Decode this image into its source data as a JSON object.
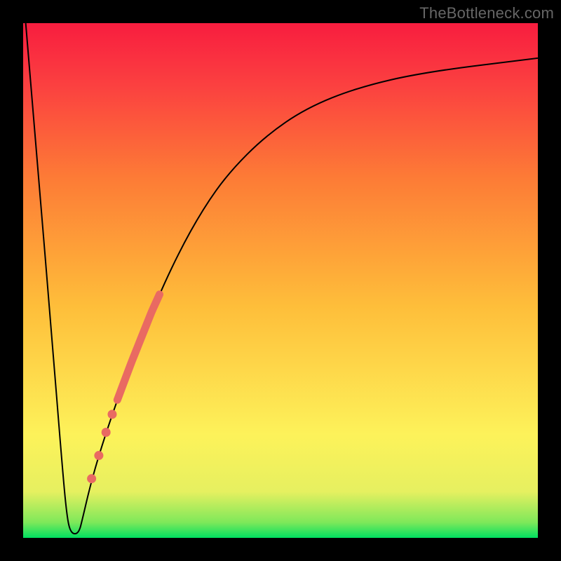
{
  "watermark": "TheBottleneck.com",
  "chart_data": {
    "type": "line",
    "title": "",
    "xlabel": "",
    "ylabel": "",
    "xlim": [
      0,
      100
    ],
    "ylim": [
      0,
      100
    ],
    "gradient_stops": [
      {
        "pos": 0.0,
        "color": "#00E060"
      },
      {
        "pos": 0.03,
        "color": "#7EE85A"
      },
      {
        "pos": 0.09,
        "color": "#E6F060"
      },
      {
        "pos": 0.2,
        "color": "#FDF25A"
      },
      {
        "pos": 0.45,
        "color": "#FEBE3A"
      },
      {
        "pos": 0.7,
        "color": "#FD7B36"
      },
      {
        "pos": 0.88,
        "color": "#FB4040"
      },
      {
        "pos": 1.0,
        "color": "#F81D3F"
      }
    ],
    "series": [
      {
        "name": "bottleneck-curve",
        "stroke": "#000000",
        "stroke_width": 2,
        "points": [
          {
            "x": 0.5,
            "y": 100.0
          },
          {
            "x": 3.0,
            "y": 70.0
          },
          {
            "x": 5.5,
            "y": 40.0
          },
          {
            "x": 7.5,
            "y": 15.0
          },
          {
            "x": 8.5,
            "y": 4.0
          },
          {
            "x": 9.3,
            "y": 0.8
          },
          {
            "x": 10.8,
            "y": 0.8
          },
          {
            "x": 11.6,
            "y": 4.0
          },
          {
            "x": 13.0,
            "y": 10.0
          },
          {
            "x": 15.0,
            "y": 17.0
          },
          {
            "x": 18.0,
            "y": 26.0
          },
          {
            "x": 21.0,
            "y": 34.0
          },
          {
            "x": 25.0,
            "y": 44.0
          },
          {
            "x": 30.0,
            "y": 55.0
          },
          {
            "x": 35.0,
            "y": 64.0
          },
          {
            "x": 40.0,
            "y": 71.0
          },
          {
            "x": 47.0,
            "y": 78.0
          },
          {
            "x": 55.0,
            "y": 83.5
          },
          {
            "x": 65.0,
            "y": 87.5
          },
          {
            "x": 78.0,
            "y": 90.5
          },
          {
            "x": 100.0,
            "y": 93.2
          }
        ]
      }
    ],
    "highlight_segment": {
      "name": "highlighted-range",
      "stroke": "#E96A62",
      "stroke_width": 11,
      "x_start": 18.3,
      "x_end": 26.5
    },
    "highlight_dots": {
      "name": "highlight-dots",
      "fill": "#E96A62",
      "r": 6.5,
      "points": [
        {
          "x": 17.3,
          "y": 24.0
        },
        {
          "x": 16.1,
          "y": 20.5
        },
        {
          "x": 14.7,
          "y": 16.0
        },
        {
          "x": 13.3,
          "y": 11.5
        }
      ]
    }
  }
}
